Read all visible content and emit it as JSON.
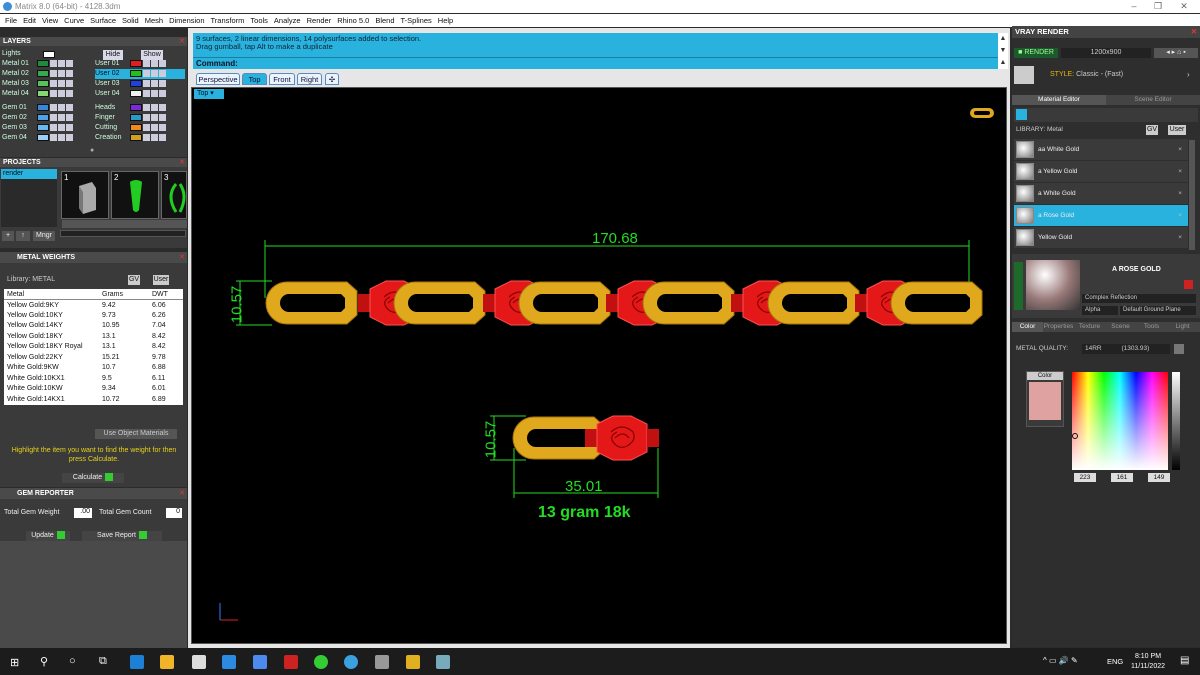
{
  "window": {
    "title": "Matrix 8.0 (64-bit) - 4128.3dm"
  },
  "menu": [
    "File",
    "Edit",
    "View",
    "Curve",
    "Surface",
    "Solid",
    "Mesh",
    "Dimension",
    "Transform",
    "Tools",
    "Analyze",
    "Render",
    "Rhino 5.0",
    "Blend",
    "T-Splines",
    "Help"
  ],
  "layers": {
    "title": "LAYERS",
    "lights": "Lights",
    "hide": "Hide",
    "show": "Show",
    "left": [
      {
        "name": "Metal 01",
        "color": "#1f8a3c"
      },
      {
        "name": "Metal 02",
        "color": "#38a84e"
      },
      {
        "name": "Metal 03",
        "color": "#56c05a"
      },
      {
        "name": "Metal 04",
        "color": "#86d676"
      },
      {
        "name": "Gem 01",
        "color": "#3a86d6"
      },
      {
        "name": "Gem 02",
        "color": "#4fa0e8"
      },
      {
        "name": "Gem 03",
        "color": "#6ab6ef"
      },
      {
        "name": "Gem 04",
        "color": "#9ad0f6"
      }
    ],
    "right": [
      {
        "name": "User 01",
        "color": "#e02020"
      },
      {
        "name": "User 02",
        "color": "#20c020"
      },
      {
        "name": "User 03",
        "color": "#2040e0"
      },
      {
        "name": "User 04",
        "color": "#f0f0f0"
      },
      {
        "name": "Heads",
        "color": "#7a2ad6"
      },
      {
        "name": "Finger",
        "color": "#2a9ac8"
      },
      {
        "name": "Cutting",
        "color": "#f08a1a"
      },
      {
        "name": "Creation",
        "color": "#d0a020"
      }
    ]
  },
  "projects": {
    "title": "PROJECTS",
    "item": "render",
    "thumbs": [
      "1",
      "2",
      "3"
    ],
    "mngr": "Mngr"
  },
  "metal_weights": {
    "title": "METAL WEIGHTS",
    "library": "Library: METAL",
    "gv": "GV",
    "user": "User",
    "headers": [
      "Metal",
      "Grams",
      "DWT"
    ],
    "rows": [
      [
        "Yellow Gold:9KY",
        "9.42",
        "6.06"
      ],
      [
        "Yellow Gold:10KY",
        "9.73",
        "6.26"
      ],
      [
        "Yellow Gold:14KY",
        "10.95",
        "7.04"
      ],
      [
        "Yellow Gold:18KY",
        "13.1",
        "8.42"
      ],
      [
        "Yellow Gold:18KY Royal",
        "13.1",
        "8.42"
      ],
      [
        "Yellow Gold:22KY",
        "15.21",
        "9.78"
      ],
      [
        "White Gold:9KW",
        "10.7",
        "6.88"
      ],
      [
        "White Gold:10KX1",
        "9.5",
        "6.11"
      ],
      [
        "White Gold:10KW",
        "9.34",
        "6.01"
      ],
      [
        "White Gold:14KX1",
        "10.72",
        "6.89"
      ]
    ],
    "use_object": "Use Object Materials",
    "hint": "Highlight the item you want to find the weight for then press Calculate.",
    "calculate": "Calculate"
  },
  "gem_reporter": {
    "title": "GEM REPORTER",
    "total_weight_label": "Total Gem Weight",
    "total_weight": ".00",
    "total_count_label": "Total Gem Count",
    "total_count": "0",
    "update": "Update",
    "save": "Save Report"
  },
  "command": {
    "history1": "9 surfaces, 2 linear dimensions, 14 polysurfaces added to selection.",
    "history2": "Drag gumball, tap Alt to make a duplicate",
    "prompt": "Command:"
  },
  "view_tabs": [
    "Perspective",
    "Top",
    "Front",
    "Right"
  ],
  "viewport": {
    "label": "Top",
    "dim_top": "170.68",
    "dim_side1": "10.57",
    "dim_side2": "10.57",
    "dim_bottom": "35.01",
    "weight_note": "13 gram 18k",
    "colors": {
      "gold": "#e0a81c",
      "gem": "#e01818",
      "dim": "#22dd22"
    }
  },
  "vray": {
    "title": "VRAY RENDER",
    "render": "RENDER",
    "resolution": "1200x900",
    "style": "Classic - (Fast)",
    "tabs": [
      "Material Editor",
      "Scene Editor"
    ],
    "library": "LIBRARY: Metal",
    "gv": "GV",
    "user": "User",
    "materials": [
      "aa White Gold",
      "a Yellow Gold",
      "a White Gold",
      "a Rose Gold",
      "Yellow Gold"
    ],
    "selected_name": "A ROSE GOLD",
    "complex": "Complex Reflection",
    "alpha": "Alpha",
    "ground": "Default Ground Plane",
    "subtabs": [
      "Color",
      "Properties",
      "Texture",
      "Scene",
      "Tools",
      "Light"
    ],
    "metal_quality_label": "METAL QUALITY:",
    "metal_quality": "14RR",
    "metal_quality_val": "(1303.93)",
    "color_label": "Color",
    "swatch": "#e0a1a1",
    "rgb": [
      "223",
      "161",
      "149"
    ]
  },
  "taskbar": {
    "lang": "ENG",
    "time": "8:10 PM",
    "date": "11/11/2022"
  }
}
